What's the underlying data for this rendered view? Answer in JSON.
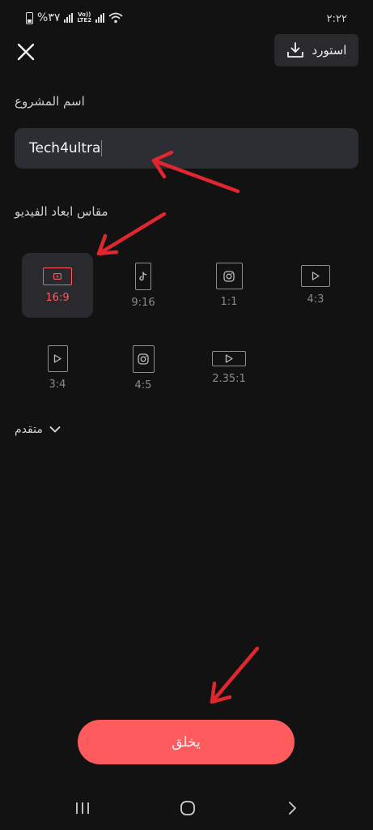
{
  "status_bar": {
    "time": "٢:٢٢",
    "battery": "%٣٧",
    "network": "Vo)) LTE2",
    "icons": [
      "battery-icon",
      "signal-icon",
      "volte-icon",
      "wifi-icon"
    ]
  },
  "header": {
    "close_icon": "close-icon",
    "export_label": "استورد",
    "export_icon": "download-icon"
  },
  "project": {
    "label": "اسم المشروع",
    "value": "Tech4ultra"
  },
  "ratio": {
    "label": "مقاس ابعاد الفيديو",
    "selected": "16:9",
    "options": [
      {
        "label": "16:9",
        "icon": "youtube-icon"
      },
      {
        "label": "9:16",
        "icon": "tiktok-icon"
      },
      {
        "label": "1:1",
        "icon": "instagram-icon"
      },
      {
        "label": "4:3",
        "icon": "play-icon"
      },
      {
        "label": "3:4",
        "icon": "play-icon"
      },
      {
        "label": "4:5",
        "icon": "instagram-icon"
      },
      {
        "label": "2.35:1",
        "icon": "play-icon"
      }
    ]
  },
  "advanced": {
    "label": "متقدم",
    "icon": "chevron-down-icon"
  },
  "create_button": {
    "label": "يخلق"
  },
  "nav_bar": {
    "recents": "recents-icon",
    "home": "home-icon",
    "back": "back-icon"
  },
  "colors": {
    "background": "#121212",
    "accent": "#fe5b5f",
    "input_bg": "#2c2e33",
    "annotation_arrow": "#e0262e"
  }
}
